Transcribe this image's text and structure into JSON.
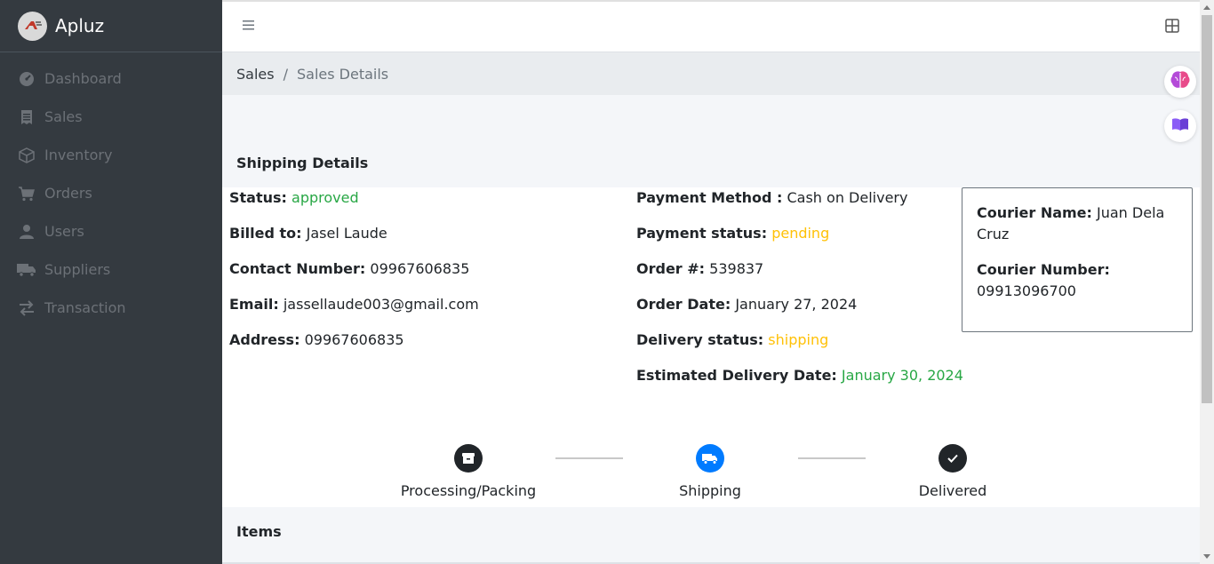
{
  "brand": {
    "name": "Apluz"
  },
  "sidebar": {
    "items": [
      {
        "label": "Dashboard",
        "icon": "dashboard-icon"
      },
      {
        "label": "Sales",
        "icon": "receipt-icon"
      },
      {
        "label": "Inventory",
        "icon": "box-icon"
      },
      {
        "label": "Orders",
        "icon": "cart-icon"
      },
      {
        "label": "Users",
        "icon": "user-icon"
      },
      {
        "label": "Suppliers",
        "icon": "truck-icon"
      },
      {
        "label": "Transaction",
        "icon": "exchange-icon"
      }
    ]
  },
  "breadcrumb": {
    "parent": "Sales",
    "separator": "/",
    "current": "Sales Details"
  },
  "shipping": {
    "title": "Shipping Details",
    "status_label": "Status:",
    "status_value": "approved",
    "billed_label": "Billed to:",
    "billed_value": "Jasel Laude",
    "contact_label": "Contact Number:",
    "contact_value": "09967606835",
    "email_label": "Email:",
    "email_value": "jassellaude003@gmail.com",
    "address_label": "Address:",
    "address_value": "09967606835",
    "payment_method_label": "Payment Method :",
    "payment_method_value": "Cash on Delivery",
    "payment_status_label": "Payment status:",
    "payment_status_value": "pending",
    "order_no_label": "Order #:",
    "order_no_value": "539837",
    "order_date_label": "Order Date:",
    "order_date_value": "January 27, 2024",
    "delivery_status_label": "Delivery status:",
    "delivery_status_value": "shipping",
    "est_delivery_label": "Estimated Delivery Date:",
    "est_delivery_value": "January 30, 2024"
  },
  "courier": {
    "name_label": "Courier Name:",
    "name_value": "Juan Dela Cruz",
    "number_label": "Courier Number:",
    "number_value": "09913096700"
  },
  "steps": [
    {
      "label": "Processing/Packing",
      "icon": "box-icon",
      "color": "#212529"
    },
    {
      "label": "Shipping",
      "icon": "truck-icon",
      "color": "#007bff"
    },
    {
      "label": "Delivered",
      "icon": "check-icon",
      "color": "#212529"
    }
  ],
  "items": {
    "title": "Items"
  },
  "colors": {
    "green": "#28a745",
    "orange": "#ffc107",
    "sidebar": "#343a40"
  }
}
